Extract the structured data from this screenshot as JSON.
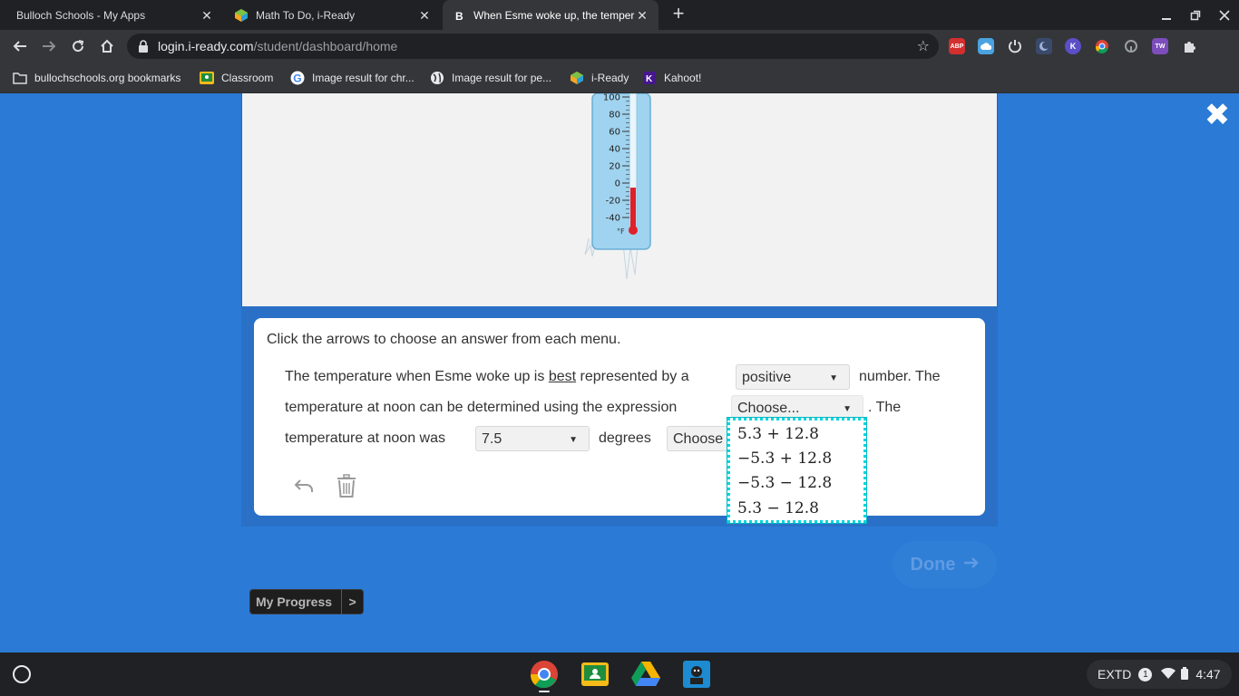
{
  "tabs": [
    {
      "title": "Bulloch Schools - My Apps",
      "close": "✕"
    },
    {
      "title": "Math To Do, i-Ready",
      "close": "✕"
    },
    {
      "title": "When Esme woke up, the temper",
      "close": "✕"
    }
  ],
  "new_tab": "+",
  "address": {
    "domain": "login.i-ready.com",
    "path": "/student/dashboard/home"
  },
  "extensions": [
    "ABP",
    "",
    "",
    "",
    "K",
    "",
    "",
    "TW",
    ""
  ],
  "bookmarks": [
    "bullochschools.org bookmarks",
    "Classroom",
    "Image result for chr...",
    "Image result for pe...",
    "i-Ready",
    "Kahoot!"
  ],
  "thermometer": {
    "ticks": [
      "100",
      "80",
      "60",
      "40",
      "20",
      "0",
      "-20",
      "-40"
    ],
    "unit": "°F",
    "reading_f": -5.3
  },
  "question": {
    "instruction": "Click the arrows to choose an answer from each menu.",
    "l1_a": "The temperature when Esme woke up is ",
    "l1_underline": "best",
    "l1_b": " represented by a",
    "dd1_value": "positive",
    "l1_c": "number. The",
    "l2_a": "temperature at noon can be determined using the expression",
    "dd2_value": "Choose...",
    "l2_b": ".  The",
    "l3_a": "temperature at noon was",
    "dd3_value": "7.5",
    "l3_b": "degrees",
    "dd4_value": "Choose"
  },
  "menu_options": [
    "5.3 + 12.8",
    "−5.3 + 12.8",
    "−5.3 − 12.8",
    "5.3 − 12.8"
  ],
  "done_label": "Done",
  "progress_label": "My Progress",
  "progress_arrow": ">",
  "tray": {
    "label": "EXTD",
    "badge": "1",
    "time": "4:47"
  },
  "colors": {
    "page_bg": "#2a7ad6",
    "menu_border": "#00d6de",
    "mercury": "#e0212a"
  }
}
